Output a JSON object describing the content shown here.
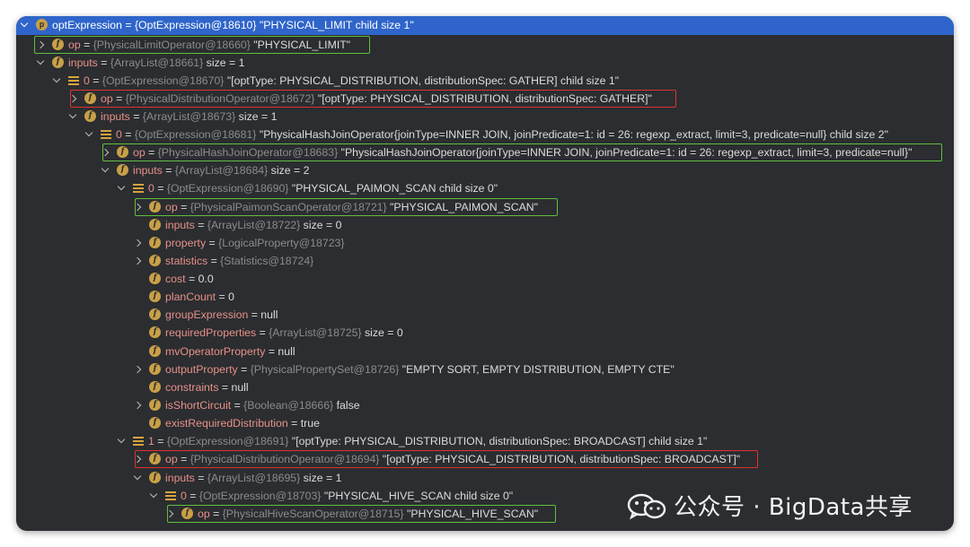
{
  "rows": [
    {
      "label": "optExpression",
      "eq": " = ",
      "type": "{OptExpression@18610}",
      "value": " \"PHYSICAL_LIMIT child size 1\""
    },
    {
      "label": "op",
      "eq": " = ",
      "type": "{PhysicalLimitOperator@18660}",
      "value": " \"PHYSICAL_LIMIT\""
    },
    {
      "label": "inputs",
      "eq": " = ",
      "type": "{ArrayList@18661}",
      "value": "  size = 1"
    },
    {
      "label": "0",
      "eq": " = ",
      "type": "{OptExpression@18670}",
      "value": " \"[optType: PHYSICAL_DISTRIBUTION, distributionSpec: GATHER] child size 1\""
    },
    {
      "label": "op",
      "eq": " = ",
      "type": "{PhysicalDistributionOperator@18672}",
      "value": " \"[optType: PHYSICAL_DISTRIBUTION, distributionSpec: GATHER]\""
    },
    {
      "label": "inputs",
      "eq": " = ",
      "type": "{ArrayList@18673}",
      "value": "  size = 1"
    },
    {
      "label": "0",
      "eq": " = ",
      "type": "{OptExpression@18681}",
      "value": " \"PhysicalHashJoinOperator{joinType=INNER JOIN, joinPredicate=1: id = 26: regexp_extract, limit=3, predicate=null} child size 2\""
    },
    {
      "label": "op",
      "eq": " = ",
      "type": "{PhysicalHashJoinOperator@18683}",
      "value": " \"PhysicalHashJoinOperator{joinType=INNER JOIN, joinPredicate=1: id = 26: regexp_extract, limit=3, predicate=null}\""
    },
    {
      "label": "inputs",
      "eq": " = ",
      "type": "{ArrayList@18684}",
      "value": "  size = 2"
    },
    {
      "label": "0",
      "eq": " = ",
      "type": "{OptExpression@18690}",
      "value": " \"PHYSICAL_PAIMON_SCAN child size 0\""
    },
    {
      "label": "op",
      "eq": " = ",
      "type": "{PhysicalPaimonScanOperator@18721}",
      "value": " \"PHYSICAL_PAIMON_SCAN\""
    },
    {
      "label": "inputs",
      "eq": " = ",
      "type": "{ArrayList@18722}",
      "value": "  size = 0"
    },
    {
      "label": "property",
      "eq": " = ",
      "type": "{LogicalProperty@18723}",
      "value": ""
    },
    {
      "label": "statistics",
      "eq": " = ",
      "type": "{Statistics@18724}",
      "value": ""
    },
    {
      "label": "cost",
      "eq": " = ",
      "type": "",
      "value": "0.0"
    },
    {
      "label": "planCount",
      "eq": " = ",
      "type": "",
      "value": "0"
    },
    {
      "label": "groupExpression",
      "eq": " = ",
      "type": "",
      "value": "null"
    },
    {
      "label": "requiredProperties",
      "eq": " = ",
      "type": "{ArrayList@18725}",
      "value": "  size = 0"
    },
    {
      "label": "mvOperatorProperty",
      "eq": " = ",
      "type": "",
      "value": "null"
    },
    {
      "label": "outputProperty",
      "eq": " = ",
      "type": "{PhysicalPropertySet@18726}",
      "value": " \"EMPTY SORT, EMPTY DISTRIBUTION, EMPTY CTE\""
    },
    {
      "label": "constraints",
      "eq": " = ",
      "type": "",
      "value": "null"
    },
    {
      "label": "isShortCircuit",
      "eq": " = ",
      "type": "{Boolean@18666}",
      "value": " false"
    },
    {
      "label": "existRequiredDistribution",
      "eq": " = ",
      "type": "",
      "value": "true"
    },
    {
      "label": "1",
      "eq": " = ",
      "type": "{OptExpression@18691}",
      "value": " \"[optType: PHYSICAL_DISTRIBUTION, distributionSpec: BROADCAST] child size 1\""
    },
    {
      "label": "op",
      "eq": " = ",
      "type": "{PhysicalDistributionOperator@18694}",
      "value": " \"[optType: PHYSICAL_DISTRIBUTION, distributionSpec: BROADCAST]\""
    },
    {
      "label": "inputs",
      "eq": " = ",
      "type": "{ArrayList@18695}",
      "value": "  size = 1"
    },
    {
      "label": "0",
      "eq": " = ",
      "type": "{OptExpression@18703}",
      "value": " \"PHYSICAL_HIVE_SCAN child size 0\""
    },
    {
      "label": "op",
      "eq": " = ",
      "type": "{PhysicalHiveScanOperator@18715}",
      "value": " \"PHYSICAL_HIVE_SCAN\""
    }
  ],
  "icons": {
    "p": "p",
    "f": "f"
  },
  "colors": {
    "selection": "#2f65ca",
    "field_icon": "#c9a047",
    "field_name": "#e8908a",
    "type_text": "#8c8c8c",
    "highlight_green": "#5fbf3f",
    "highlight_red": "#e0312e"
  },
  "watermark": {
    "text": "公众号 · BigData共享"
  }
}
